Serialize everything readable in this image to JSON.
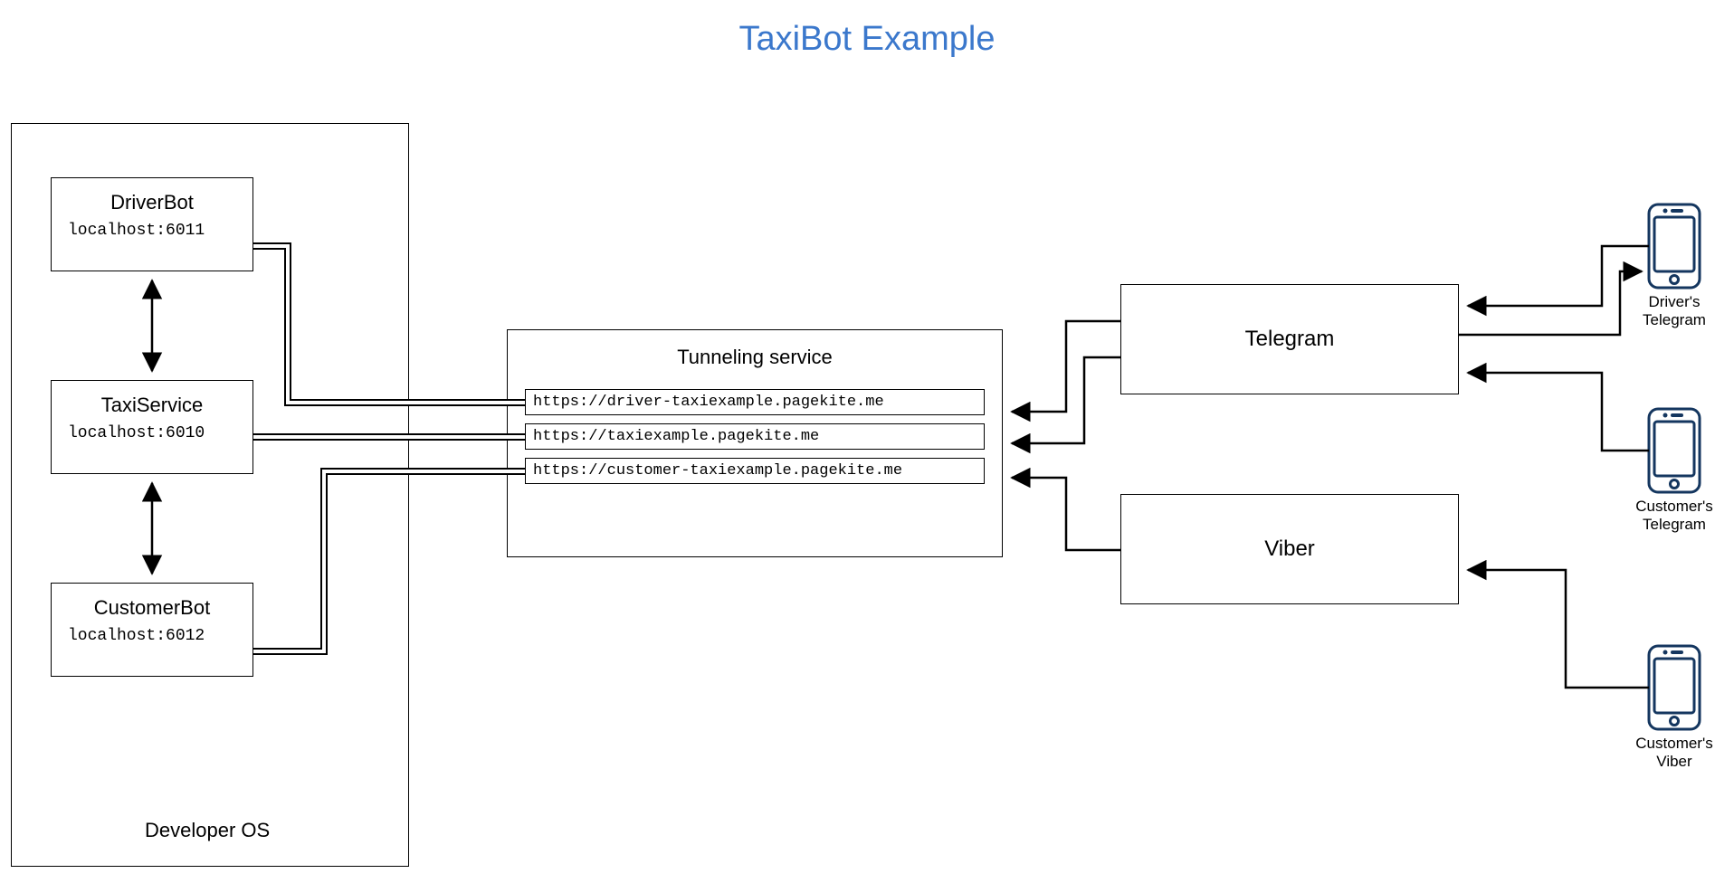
{
  "title": "TaxiBot Example",
  "developer_os_label": "Developer OS",
  "services": {
    "driver_bot": {
      "name": "DriverBot",
      "addr": "localhost:6011"
    },
    "taxi_service": {
      "name": "TaxiService",
      "addr": "localhost:6010"
    },
    "customer_bot": {
      "name": "CustomerBot",
      "addr": "localhost:6012"
    }
  },
  "tunnel": {
    "title": "Tunneling service",
    "urls": {
      "driver": "https://driver-taxiexample.pagekite.me",
      "taxi": "https://taxiexample.pagekite.me",
      "customer": "https://customer-taxiexample.pagekite.me"
    }
  },
  "messengers": {
    "telegram": "Telegram",
    "viber": "Viber"
  },
  "clients": {
    "driver_telegram": "Driver's\nTelegram",
    "customer_telegram": "Customer's\nTelegram",
    "customer_viber": "Customer's\nViber"
  }
}
